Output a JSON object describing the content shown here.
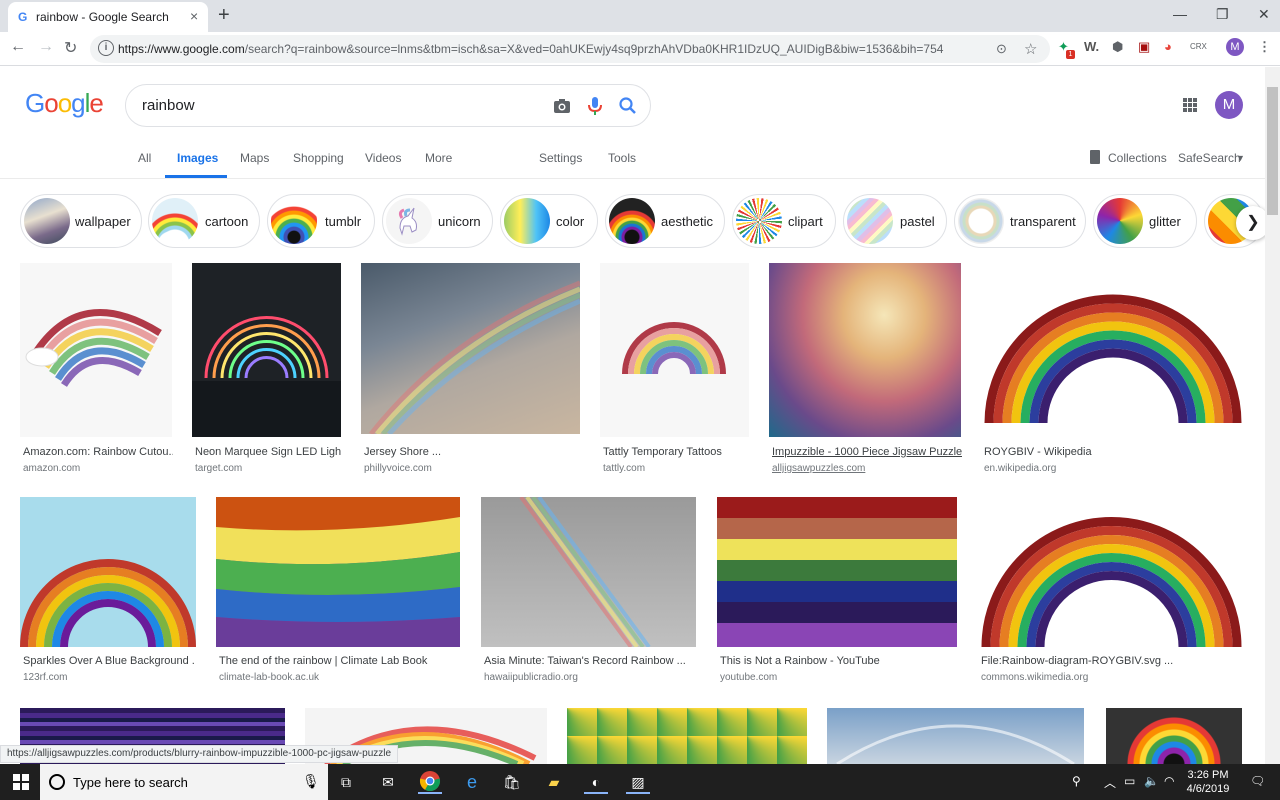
{
  "browser": {
    "tab_title": "rainbow - Google Search",
    "tab_favicon": "G",
    "close_glyph": "×",
    "newtab_glyph": "+",
    "url_host": "https://www.google.com",
    "url_rest": "/search?q=rainbow&source=lnms&tbm=isch&sa=X&ved=0ahUKEwjy4sq9przhAhVDba0KHR1IDzUQ_AUIDigB&biw=1536&bih=754",
    "profile_initial": "M",
    "extension_labels": [
      "W.",
      "CRX"
    ]
  },
  "google": {
    "logo": [
      "G",
      "o",
      "o",
      "g",
      "l",
      "e"
    ],
    "logo_colors": [
      "#4285f4",
      "#ea4335",
      "#fbbc05",
      "#4285f4",
      "#34a853",
      "#ea4335"
    ],
    "query": "rainbow",
    "avatar_initial": "M",
    "nav": {
      "all": "All",
      "images": "Images",
      "maps": "Maps",
      "shopping": "Shopping",
      "videos": "Videos",
      "more": "More",
      "settings": "Settings",
      "tools": "Tools",
      "collections": "Collections",
      "safesearch": "SafeSearch"
    },
    "chips": [
      "wallpaper",
      "cartoon",
      "tumblr",
      "unicorn",
      "color",
      "aesthetic",
      "clipart",
      "pastel",
      "transparent",
      "glitter"
    ]
  },
  "results": [
    {
      "caption": "Amazon.com: Rainbow Cutou...",
      "source": "amazon.com"
    },
    {
      "caption": "Neon Marquee Sign LED Ligh...",
      "source": "target.com"
    },
    {
      "caption": "Jersey Shore ...",
      "source": "phillyvoice.com"
    },
    {
      "caption": "Tattly Temporary Tattoos",
      "source": "tattly.com"
    },
    {
      "caption": "Impuzzible - 1000 Piece Jigsaw Puzzle",
      "source": "alljigsawpuzzles.com"
    },
    {
      "caption": "ROYGBIV - Wikipedia",
      "source": "en.wikipedia.org"
    },
    {
      "caption": "Sparkles Over A Blue Background ...",
      "source": "123rf.com"
    },
    {
      "caption": "The end of the rainbow | Climate Lab Book",
      "source": "climate-lab-book.ac.uk"
    },
    {
      "caption": "Asia Minute: Taiwan's Record Rainbow ...",
      "source": "hawaiipublicradio.org"
    },
    {
      "caption": "This is Not a Rainbow - YouTube",
      "source": "youtube.com"
    },
    {
      "caption": "File:Rainbow-diagram-ROYGBIV.svg ...",
      "source": "commons.wikimedia.org"
    }
  ],
  "status_url": "https://alljigsawpuzzles.com/products/blurry-rainbow-impuzzible-1000-pc-jigsaw-puzzle",
  "taskbar": {
    "search_placeholder": "Type here to search",
    "time": "3:26 PM",
    "date": "4/6/2019"
  }
}
